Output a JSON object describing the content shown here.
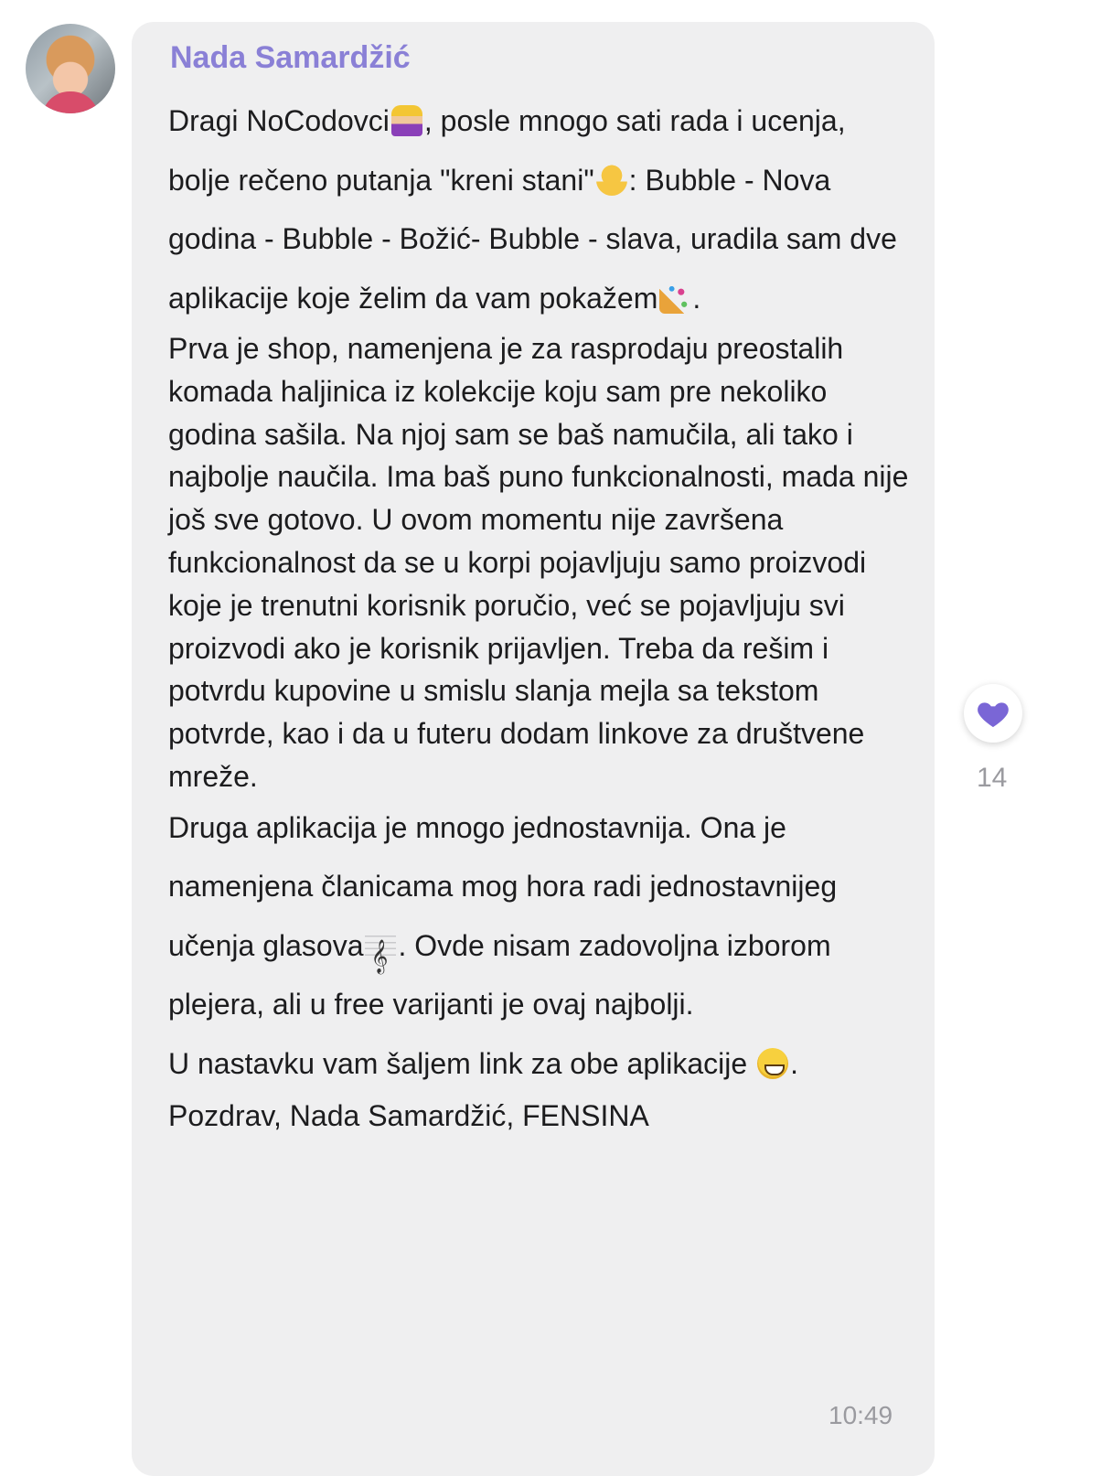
{
  "message": {
    "sender": "Nada Samardžić",
    "text_1a": "Dragi NoCodovci",
    "text_1b": ", posle mnogo sati rada i ucenja, bolje rečeno putanja \"kreni stani\"",
    "text_1c": ": Bubble - Nova godina - Bubble - Božić- Bubble - slava, uradila sam dve aplikacije koje želim da vam pokažem",
    "text_1d": ".",
    "text_2": "Prva je shop, namenjena je za rasprodaju preostalih komada haljinica iz kolekcije koju sam pre nekoliko godina sašila. Na njoj sam se baš namučila, ali tako i najbolje naučila. Ima baš puno funkcionalnosti, mada nije još sve gotovo. U ovom momentu nije završena funkcionalnost da se u korpi pojavljuju samo proizvodi koje je trenutni korisnik poručio, već se pojavljuju svi proizvodi ako je korisnik prijavljen. Treba da rešim i potvrdu kupovine u smislu slanja mejla sa tekstom potvrde, kao i da u futeru dodam linkove za društvene mreže.",
    "text_3a": "Druga aplikacija je mnogo jednostavnija. Ona je namenjena članicama mog hora radi jednostavnijeg učenja glasova",
    "text_3b": ". Ovde nisam zadovoljna izborom plejera, ali u free varijanti je ovaj najbolji.",
    "text_4a": "U nastavku vam šaljem link za obe aplikacije ",
    "text_4b": ".",
    "text_5": "Pozdrav, Nada Samardžić, FENSINA",
    "time": "10:49"
  },
  "reaction": {
    "icon": "purple-heart-icon",
    "color": "#7a66d6",
    "count": "14"
  },
  "emojis": [
    "superhero-emoji",
    "face-with-hand-emoji",
    "party-popper-emoji",
    "musical-score-emoji",
    "grinning-face-emoji"
  ],
  "colors": {
    "sender_name": "#8a80d6",
    "bubble": "#efeff0",
    "text": "#1c1c1e",
    "meta": "#9a9a9f"
  }
}
